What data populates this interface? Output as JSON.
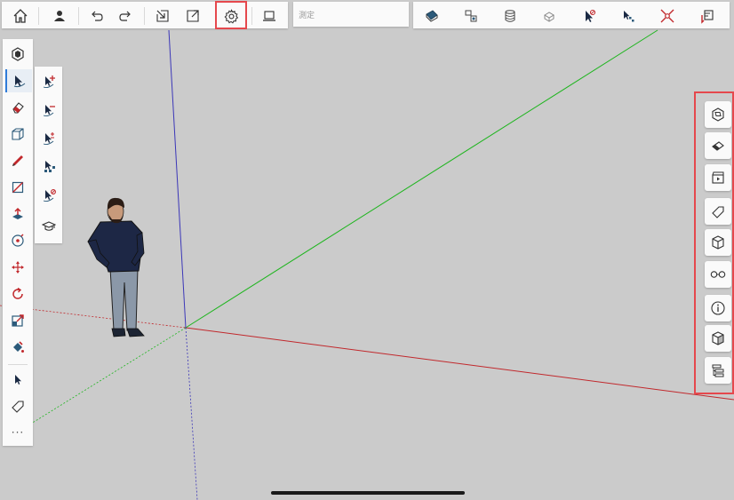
{
  "toolbar_top": {
    "left_icons": [
      "home-icon",
      "account-icon",
      "undo-icon",
      "redo-icon",
      "import-icon",
      "export-icon",
      "settings-icon",
      "display-icon"
    ],
    "measurements_label": "測定",
    "right_icons": [
      "3d-warehouse-icon",
      "components-icon",
      "materials-icon",
      "solid-tools-icon",
      "select-none-icon",
      "select-tool-icon",
      "fit-view-icon",
      "sketch-view-icon"
    ]
  },
  "toolbar_left": {
    "tools": [
      "tools-icon",
      "select-icon",
      "eraser-icon",
      "line-style-icon",
      "pencil-icon",
      "rectangle-icon",
      "push-pull-icon",
      "orbit-icon",
      "move-icon",
      "rotate-icon",
      "scale-icon",
      "paint-icon",
      "arrow-icon",
      "tag-icon"
    ],
    "more_label": "···"
  },
  "select_flyout": {
    "tools": [
      "select-add-icon",
      "select-subtract-icon",
      "select-toggle-icon",
      "select-group-icon",
      "select-none-icon",
      "learn-icon"
    ]
  },
  "panel_right": {
    "buttons": [
      "entity-info-icon",
      "eraser-panel-icon",
      "scenes-icon",
      "tags-icon",
      "components-panel-icon",
      "views-icon",
      "info-icon",
      "solid-panel-icon",
      "outliner-icon"
    ]
  },
  "colors": {
    "canvas": "#cbcbcb",
    "x_axis": "#c1282c",
    "y_axis": "#1fb51f",
    "z_axis": "#3b36b8",
    "highlight": "#e5484d",
    "active_tool": "#e8eef5"
  }
}
